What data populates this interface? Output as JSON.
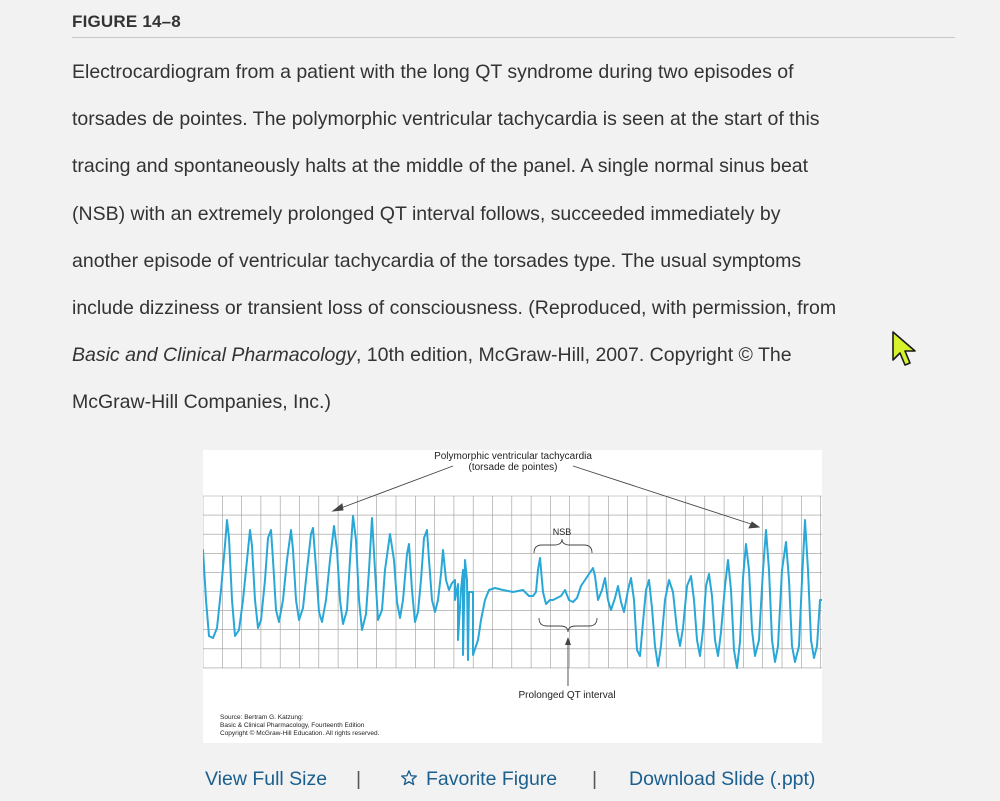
{
  "figure": {
    "label": "FIGURE 14–8",
    "caption_lines": [
      "Electrocardiogram from a patient with the long QT syndrome during two episodes of",
      "torsades de pointes. The polymorphic ventricular tachycardia is seen at the start of this",
      "tracing and spontaneously halts at the middle of the panel. A single normal sinus beat",
      "(NSB) with an extremely prolonged QT interval follows, succeeded immediately by",
      "another episode of ventricular tachycardia of the torsades type. The usual symptoms",
      "include dizziness or transient loss of consciousness. (Reproduced, with permission, from"
    ],
    "caption_book_title": "Basic and Clinical Pharmacology",
    "caption_after_title": ", 10th edition, McGraw-Hill, 2007. Copyright © The",
    "caption_last_line": "McGraw-Hill Companies, Inc.)"
  },
  "image": {
    "annotation_top_1": "Polymorphic ventricular tachycardia",
    "annotation_top_2": "(torsade de pointes)",
    "annotation_nsb": "NSB",
    "annotation_bottom": "Prolonged QT interval",
    "source_lines": [
      "Source: Bertram G. Katzung:",
      "Basic & Clinical Pharmacology, Fourteenth Edition",
      "Copyright © McGraw-Hill Education. All rights reserved."
    ],
    "trace_color": "#29a8d8"
  },
  "actions": {
    "view_full_size": "View Full Size",
    "separator": "|",
    "favorite_figure": "Favorite Figure",
    "download_slide": "Download Slide (.ppt)"
  },
  "colors": {
    "link": "#1a5f8e",
    "background": "#f2f2f2"
  },
  "icons": {
    "favorite": "star-outline-icon",
    "cursor": "mouse-pointer-icon"
  }
}
